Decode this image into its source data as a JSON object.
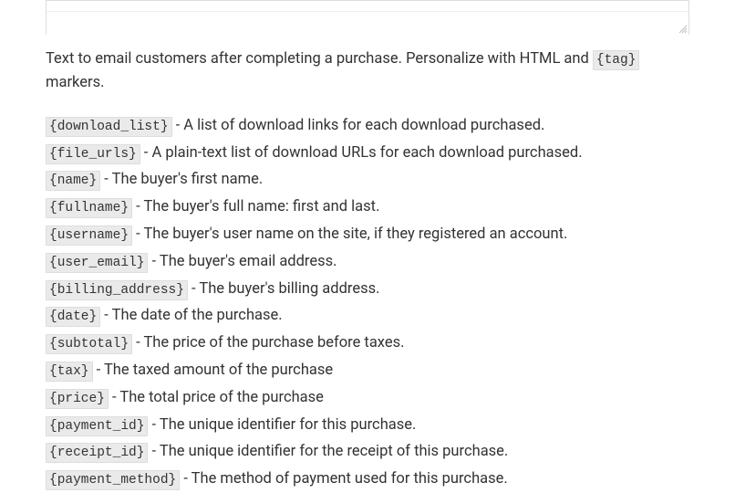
{
  "intro": {
    "prefix": "Text to email customers after completing a purchase. Personalize with HTML and ",
    "tag": "{tag}",
    "suffix": " markers."
  },
  "tags": [
    {
      "code": "{download_list}",
      "desc": " - A list of download links for each download purchased."
    },
    {
      "code": "{file_urls}",
      "desc": " - A plain-text list of download URLs for each download purchased."
    },
    {
      "code": "{name}",
      "desc": " - The buyer's first name."
    },
    {
      "code": "{fullname}",
      "desc": " - The buyer's full name: first and last."
    },
    {
      "code": "{username}",
      "desc": " - The buyer's user name on the site, if they registered an account."
    },
    {
      "code": "{user_email}",
      "desc": " - The buyer's email address."
    },
    {
      "code": "{billing_address}",
      "desc": " - The buyer's billing address."
    },
    {
      "code": "{date}",
      "desc": " - The date of the purchase."
    },
    {
      "code": "{subtotal}",
      "desc": " - The price of the purchase before taxes."
    },
    {
      "code": "{tax}",
      "desc": " - The taxed amount of the purchase"
    },
    {
      "code": "{price}",
      "desc": " - The total price of the purchase"
    },
    {
      "code": "{payment_id}",
      "desc": " - The unique identifier for this purchase."
    },
    {
      "code": "{receipt_id}",
      "desc": " - The unique identifier for the receipt of this purchase."
    },
    {
      "code": "{payment_method}",
      "desc": " - The method of payment used for this purchase."
    }
  ]
}
